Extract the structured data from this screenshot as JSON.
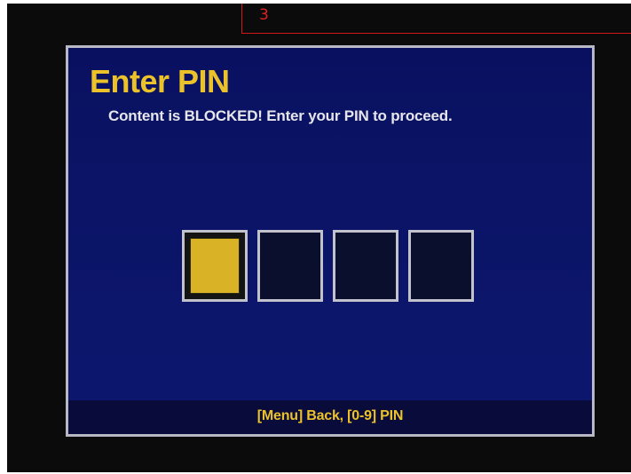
{
  "overlay": {
    "label": "3",
    "color": "#e02020"
  },
  "dialog": {
    "title": "Enter PIN",
    "message": "Content is BLOCKED!  Enter your PIN to proceed.",
    "footer_hint": "[Menu] Back, [0-9] PIN",
    "colors": {
      "title": "#ecc22a",
      "background": "#0b1466",
      "border": "#b8b8c4"
    }
  },
  "pin": {
    "digit_count": 4,
    "active_index": 0,
    "entered_digits": 0,
    "slots": [
      {
        "state": "active"
      },
      {
        "state": "empty"
      },
      {
        "state": "empty"
      },
      {
        "state": "empty"
      }
    ]
  }
}
